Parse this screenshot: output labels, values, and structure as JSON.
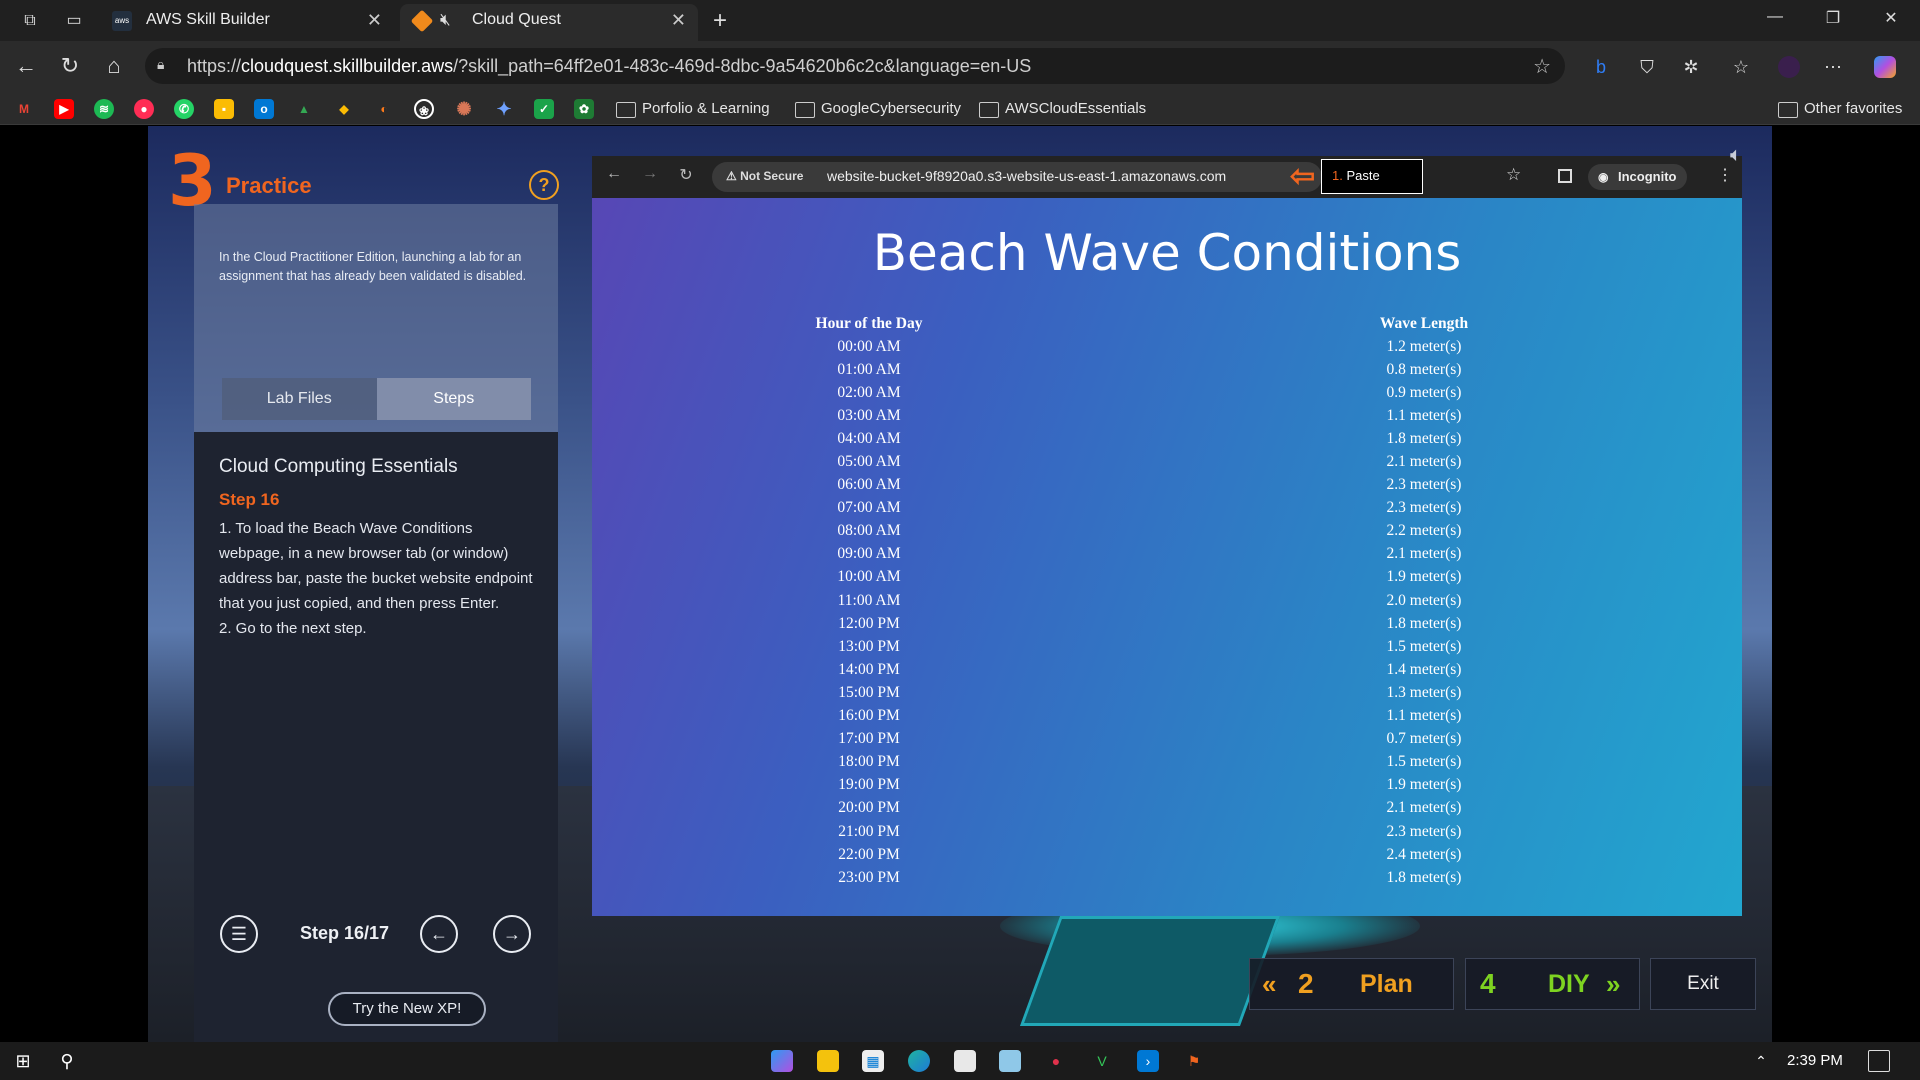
{
  "browser": {
    "tabs": [
      {
        "title": "AWS Skill Builder",
        "favicon": "aws-icon",
        "active": false
      },
      {
        "title": "Cloud Quest",
        "favicon": "cloudquest-icon",
        "active": true,
        "muted": true
      }
    ],
    "url_prefix": "https://",
    "url_host": "cloudquest.skillbuilder.aws",
    "url_rest": "/?skill_path=64ff2e01-483c-469d-8dbc-9a54620b6c2c&language=en-US",
    "bookmark_folders": [
      "Porfolio & Learning",
      "GoogleCybersecurity",
      "AWSCloudEssentials"
    ],
    "other_favorites": "Other favorites"
  },
  "practice": {
    "number": "3",
    "label": "Practice",
    "help": "?",
    "notice": "In the Cloud Practitioner Edition, launching a lab for an assignment that has already been validated is disabled.",
    "tabs": [
      "Lab Files",
      "Steps"
    ],
    "selected_tab": "Steps",
    "course_title": "Cloud Computing Essentials",
    "step_label": "Step 16",
    "step_line1": "1. To load the Beach Wave Conditions webpage, in a new browser tab (or window) address bar, paste the bucket website endpoint that you just copied, and then press Enter.",
    "step_line2": "2. Go to the next step.",
    "step_counter": "Step 16/17",
    "try_button": "Try the New XP!"
  },
  "embedded_browser": {
    "not_secure": "Not Secure",
    "url": "website-bucket-9f8920a0.s3-website-us-east-1.amazonaws.com",
    "paste_num": "1.",
    "paste_label": "Paste",
    "incognito": "Incognito"
  },
  "wave_page": {
    "title": "Beach Wave Conditions",
    "headers": [
      "Hour of the Day",
      "Wave Length"
    ],
    "rows": [
      [
        "00:00 AM",
        "1.2 meter(s)"
      ],
      [
        "01:00 AM",
        "0.8 meter(s)"
      ],
      [
        "02:00 AM",
        "0.9 meter(s)"
      ],
      [
        "03:00 AM",
        "1.1 meter(s)"
      ],
      [
        "04:00 AM",
        "1.8 meter(s)"
      ],
      [
        "05:00 AM",
        "2.1 meter(s)"
      ],
      [
        "06:00 AM",
        "2.3 meter(s)"
      ],
      [
        "07:00 AM",
        "2.3 meter(s)"
      ],
      [
        "08:00 AM",
        "2.2 meter(s)"
      ],
      [
        "09:00 AM",
        "2.1 meter(s)"
      ],
      [
        "10:00 AM",
        "1.9 meter(s)"
      ],
      [
        "11:00 AM",
        "2.0 meter(s)"
      ],
      [
        "12:00 PM",
        "1.8 meter(s)"
      ],
      [
        "13:00 PM",
        "1.5 meter(s)"
      ],
      [
        "14:00 PM",
        "1.4 meter(s)"
      ],
      [
        "15:00 PM",
        "1.3 meter(s)"
      ],
      [
        "16:00 PM",
        "1.1 meter(s)"
      ],
      [
        "17:00 PM",
        "0.7 meter(s)"
      ],
      [
        "18:00 PM",
        "1.5 meter(s)"
      ],
      [
        "19:00 PM",
        "1.9 meter(s)"
      ],
      [
        "20:00 PM",
        "2.1 meter(s)"
      ],
      [
        "21:00 PM",
        "2.3 meter(s)"
      ],
      [
        "22:00 PM",
        "2.4 meter(s)"
      ],
      [
        "23:00 PM",
        "1.8 meter(s)"
      ]
    ]
  },
  "bottom_nav": {
    "plan_num": "2",
    "plan_label": "Plan",
    "diy_num": "4",
    "diy_label": "DIY",
    "exit_label": "Exit"
  },
  "taskbar": {
    "time": "2:39 PM"
  },
  "colors": {
    "accent_orange": "#f0651f",
    "diy_green": "#7ed321",
    "plan_orange": "#f0a020"
  }
}
